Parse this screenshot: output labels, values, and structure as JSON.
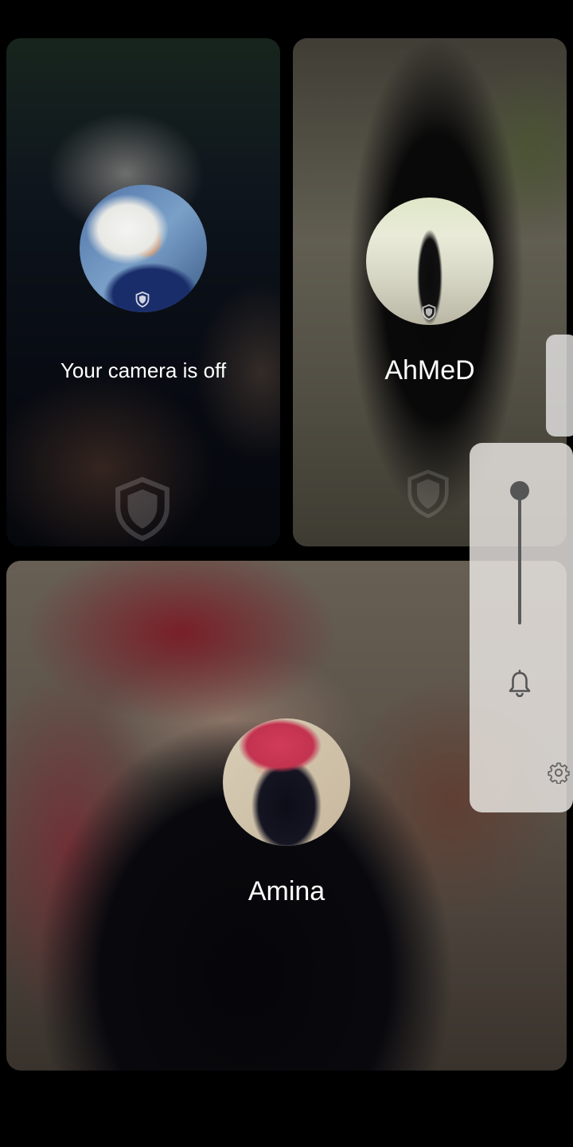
{
  "call": {
    "self": {
      "status_text": "Your camera is off",
      "avatar_icon": "user-photo"
    },
    "participants": [
      {
        "name": "AhMeD",
        "avatar_icon": "user-photo"
      },
      {
        "name": "Amina",
        "avatar_icon": "user-photo"
      }
    ]
  },
  "volume_panel": {
    "level": 1.0,
    "icons": [
      "bell-icon",
      "gear-icon"
    ]
  },
  "colors": {
    "background": "#000000",
    "label_text": "#ffffff",
    "panel_bg": "#ebe8e4",
    "panel_control": "#555555"
  }
}
